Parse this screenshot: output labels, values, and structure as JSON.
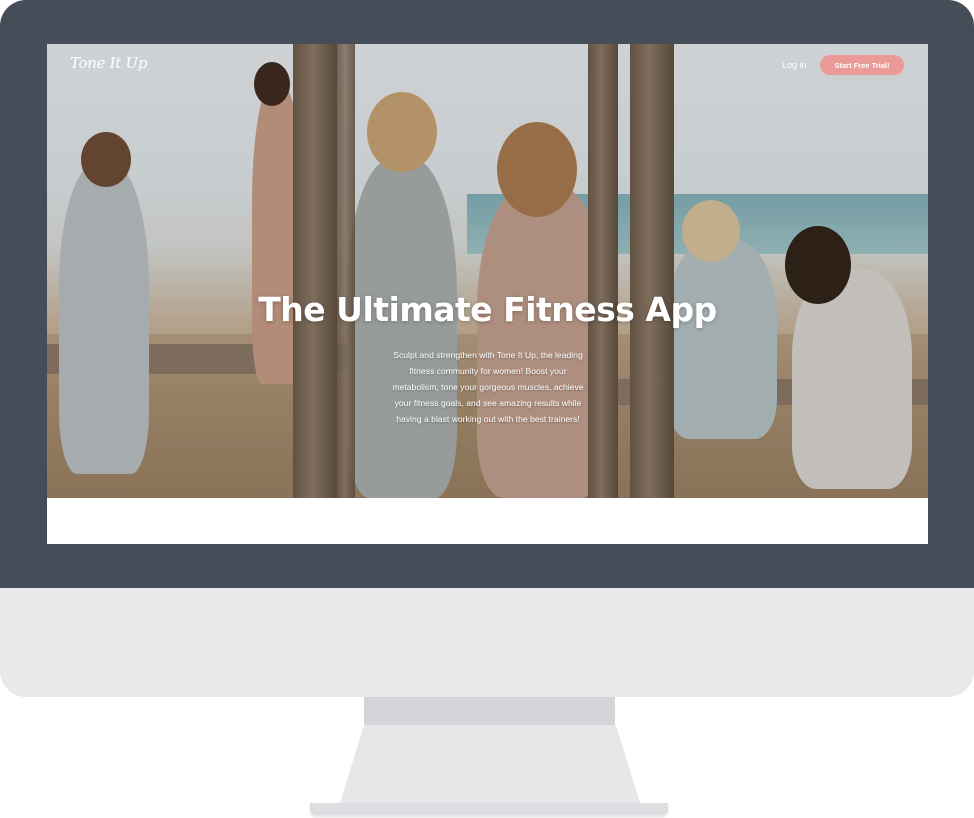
{
  "site": {
    "logo_text": "Tone It Up",
    "nav": {
      "login_label": "Log in",
      "cta_label": "Start Free Trial!"
    },
    "hero": {
      "headline": "The Ultimate Fitness App",
      "subtext": "Sculpt and strengthen with Tone It Up, the leading fitness community for women! Boost your metabolism, tone your gorgeous muscles, achieve your fitness goals, and see amazing results while having a blast working out with the best trainers!"
    }
  },
  "colors": {
    "monitor_bezel": "#454d58",
    "monitor_chin": "#e8e9eb",
    "cta_background": "#eb9a98",
    "cta_text": "#ffffff"
  }
}
